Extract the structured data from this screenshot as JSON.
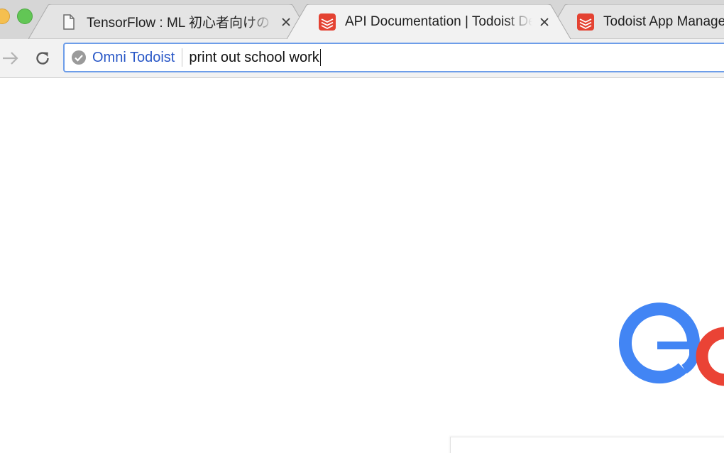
{
  "tabs": [
    {
      "title": "TensorFlow : ML 初心者向けの MNIST",
      "favicon": "document-icon",
      "active": false
    },
    {
      "title": "API Documentation | Todoist Developer",
      "favicon": "todoist-icon",
      "active": true
    },
    {
      "title": "Todoist App Management",
      "favicon": "todoist-icon",
      "active": false
    }
  ],
  "omnibox": {
    "keyword": "Omni Todoist",
    "query": "print out school work"
  },
  "colors": {
    "todoist_red": "#e44232",
    "google_blue": "#4285f4",
    "google_red": "#ea4335",
    "omnibox_focus": "#6d9de9",
    "keyword_blue": "#2a58c7"
  }
}
